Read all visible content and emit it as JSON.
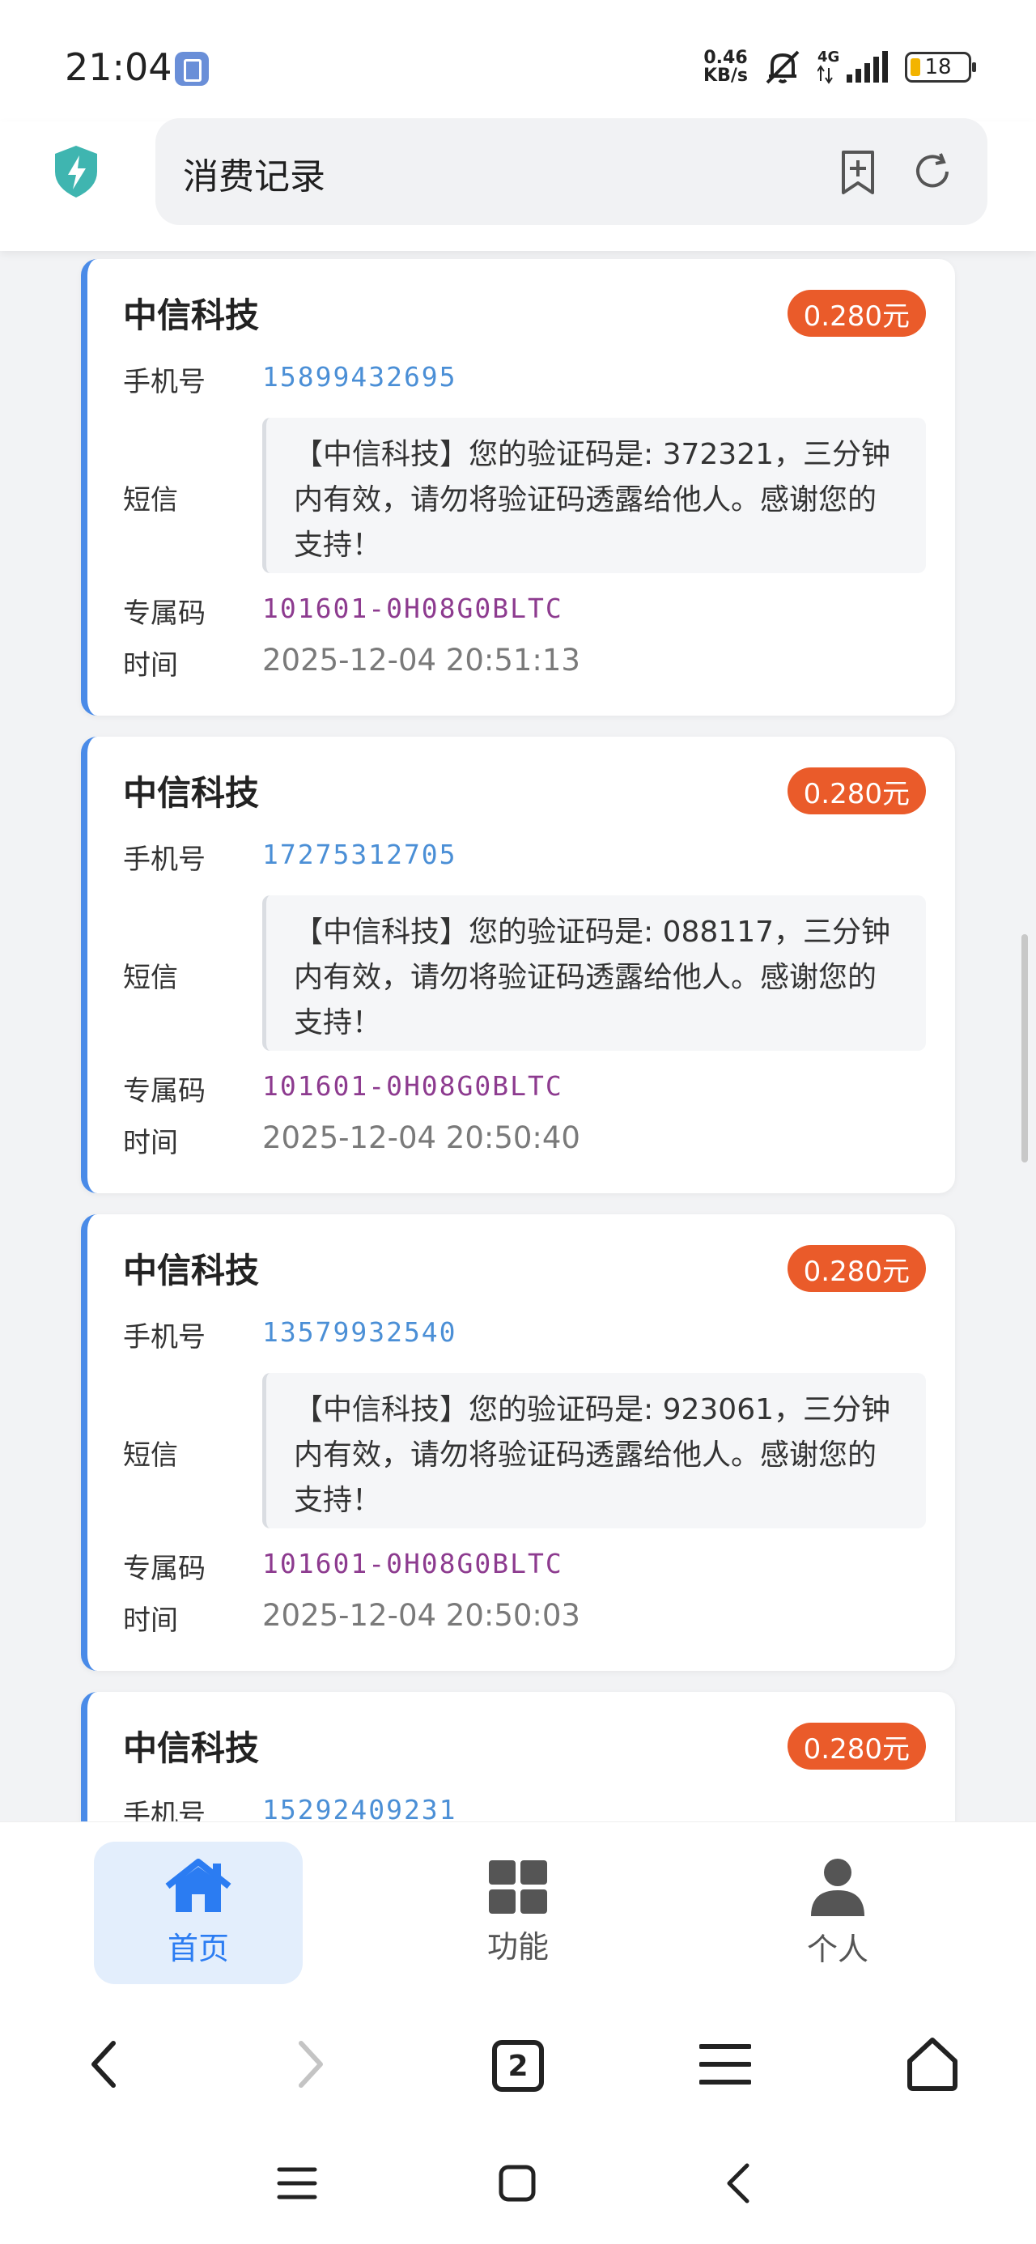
{
  "status_bar": {
    "time": "21:04",
    "net_speed_value": "0.46",
    "net_speed_unit": "KB/s",
    "network": "4G",
    "battery": "18"
  },
  "header": {
    "title": "消费记录"
  },
  "labels": {
    "phone": "手机号",
    "sms": "短信",
    "code": "专属码",
    "time": "时间"
  },
  "records": [
    {
      "company": "中信科技",
      "price": "0.280元",
      "phone": "15899432695",
      "sms": "【中信科技】您的验证码是: 372321，三分钟内有效，请勿将验证码透露给他人。感谢您的支持！",
      "code": "101601-0H08G0BLTC",
      "time": "2025-12-04 20:51:13"
    },
    {
      "company": "中信科技",
      "price": "0.280元",
      "phone": "17275312705",
      "sms": "【中信科技】您的验证码是: 088117，三分钟内有效，请勿将验证码透露给他人。感谢您的支持！",
      "code": "101601-0H08G0BLTC",
      "time": "2025-12-04 20:50:40"
    },
    {
      "company": "中信科技",
      "price": "0.280元",
      "phone": "13579932540",
      "sms": "【中信科技】您的验证码是: 923061，三分钟内有效，请勿将验证码透露给他人。感谢您的支持！",
      "code": "101601-0H08G0BLTC",
      "time": "2025-12-04 20:50:03"
    },
    {
      "company": "中信科技",
      "price": "0.280元",
      "phone": "15292409231"
    }
  ],
  "bottom_nav": [
    {
      "label": "首页",
      "icon": "home-icon",
      "active": true
    },
    {
      "label": "功能",
      "icon": "grid-icon",
      "active": false
    },
    {
      "label": "个人",
      "icon": "person-icon",
      "active": false
    }
  ],
  "browser_bar": {
    "tab_count": "2"
  },
  "colors": {
    "accent": "#2b7cf2",
    "price_badge": "#ea5b2a",
    "phone_text": "#4b8fd6",
    "code_text": "#8d3b8f",
    "card_border": "#4a8be8"
  }
}
